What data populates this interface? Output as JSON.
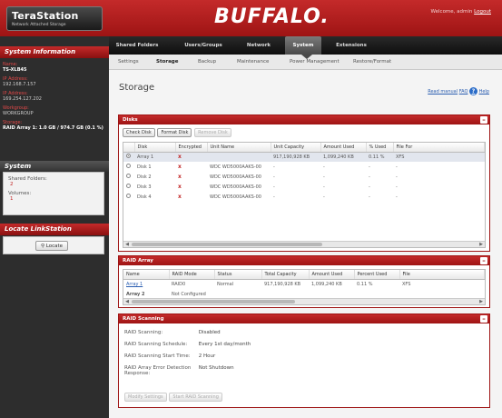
{
  "header": {
    "logo_title": "TeraStation",
    "logo_subtitle": "Network Attached Storage",
    "brand": "BUFFALO.",
    "welcome_text": "Welcome, admin",
    "logout": "Logout"
  },
  "nav": {
    "tabs": [
      "Shared Folders",
      "Users/Groups",
      "Network",
      "System",
      "Extensions"
    ],
    "active": "System"
  },
  "subnav": {
    "tabs": [
      "Settings",
      "Storage",
      "Backup",
      "Maintenance",
      "Power Management",
      "Restore/Format"
    ],
    "active": "Storage"
  },
  "sidebar": {
    "system_information_title": "System Information",
    "name_label": "Name:",
    "name_value": "TS-XLB45",
    "ip_label": "IP Address:",
    "ip_value": "192.168.7.157",
    "ip2_label": "IP Address:",
    "ip2_value": "169.254.127.202",
    "workgroup_label": "Workgroup:",
    "workgroup_value": "WORKGROUP",
    "storage_label": "Storage:",
    "storage_value": "RAID Array 1: 1.0 GB / 974.7 GB (0.1 %)",
    "system_title": "System",
    "shared_folders_label": "Shared Folders:",
    "shared_folders_value": "2",
    "volumes_label": "Volumes:",
    "volumes_value": "1",
    "locate_title": "Locate LinkStation",
    "locate_button": "Locate"
  },
  "main": {
    "title": "Storage",
    "help_links": {
      "manual": "Read manual",
      "faq": "FAQ",
      "help": "Help"
    }
  },
  "disks": {
    "title": "Disks",
    "buttons": [
      "Check Disk",
      "Format Disk",
      "Remove Disk"
    ],
    "columns": [
      "",
      "Disk",
      "Encrypted",
      "Unit Name",
      "Unit Capacity",
      "Amount Used",
      "% Used",
      "File For"
    ],
    "rows": [
      {
        "selected": true,
        "disk": "Array 1",
        "encrypted": "x",
        "unit": "",
        "capacity": "917,190,928 KB",
        "used": "1,099,240 KB",
        "pct": "0.11 %",
        "fs": "XFS"
      },
      {
        "selected": false,
        "disk": "Disk 1",
        "encrypted": "x",
        "unit": "WDC WD5000AAKS-00",
        "capacity": "-",
        "used": "-",
        "pct": "-",
        "fs": "-"
      },
      {
        "selected": false,
        "disk": "Disk 2",
        "encrypted": "x",
        "unit": "WDC WD5000AAKS-00",
        "capacity": "-",
        "used": "-",
        "pct": "-",
        "fs": "-"
      },
      {
        "selected": false,
        "disk": "Disk 3",
        "encrypted": "x",
        "unit": "WDC WD5000AAKS-00",
        "capacity": "-",
        "used": "-",
        "pct": "-",
        "fs": "-"
      },
      {
        "selected": false,
        "disk": "Disk 4",
        "encrypted": "x",
        "unit": "WDC WD5000AAKS-00",
        "capacity": "-",
        "used": "-",
        "pct": "-",
        "fs": "-"
      }
    ]
  },
  "raid": {
    "title": "RAID Array",
    "columns": [
      "Name",
      "RAID Mode",
      "Status",
      "Total Capacity",
      "Amount Used",
      "Percent Used",
      "File"
    ],
    "rows": [
      {
        "name": "Array 1",
        "mode": "RAID0",
        "status": "Normal",
        "capacity": "917,190,928 KB",
        "used": "1,099,240 KB",
        "pct": "0.11 %",
        "fs": "XFS"
      },
      {
        "name": "Array 2",
        "mode": "Not Configured",
        "status": "",
        "capacity": "",
        "used": "",
        "pct": "",
        "fs": ""
      }
    ]
  },
  "scanning": {
    "title": "RAID Scanning",
    "items": [
      {
        "label": "RAID Scanning:",
        "value": "Disabled"
      },
      {
        "label": "RAID Scanning Schedule:",
        "value": "Every 1st day/month"
      },
      {
        "label": "RAID Scanning Start Time:",
        "value": "2 Hour"
      },
      {
        "label": "RAID Array Error Detection Response:",
        "value": "Not Shutdown"
      }
    ],
    "buttons": [
      "Modify Settings",
      "Start RAID Scanning"
    ]
  }
}
